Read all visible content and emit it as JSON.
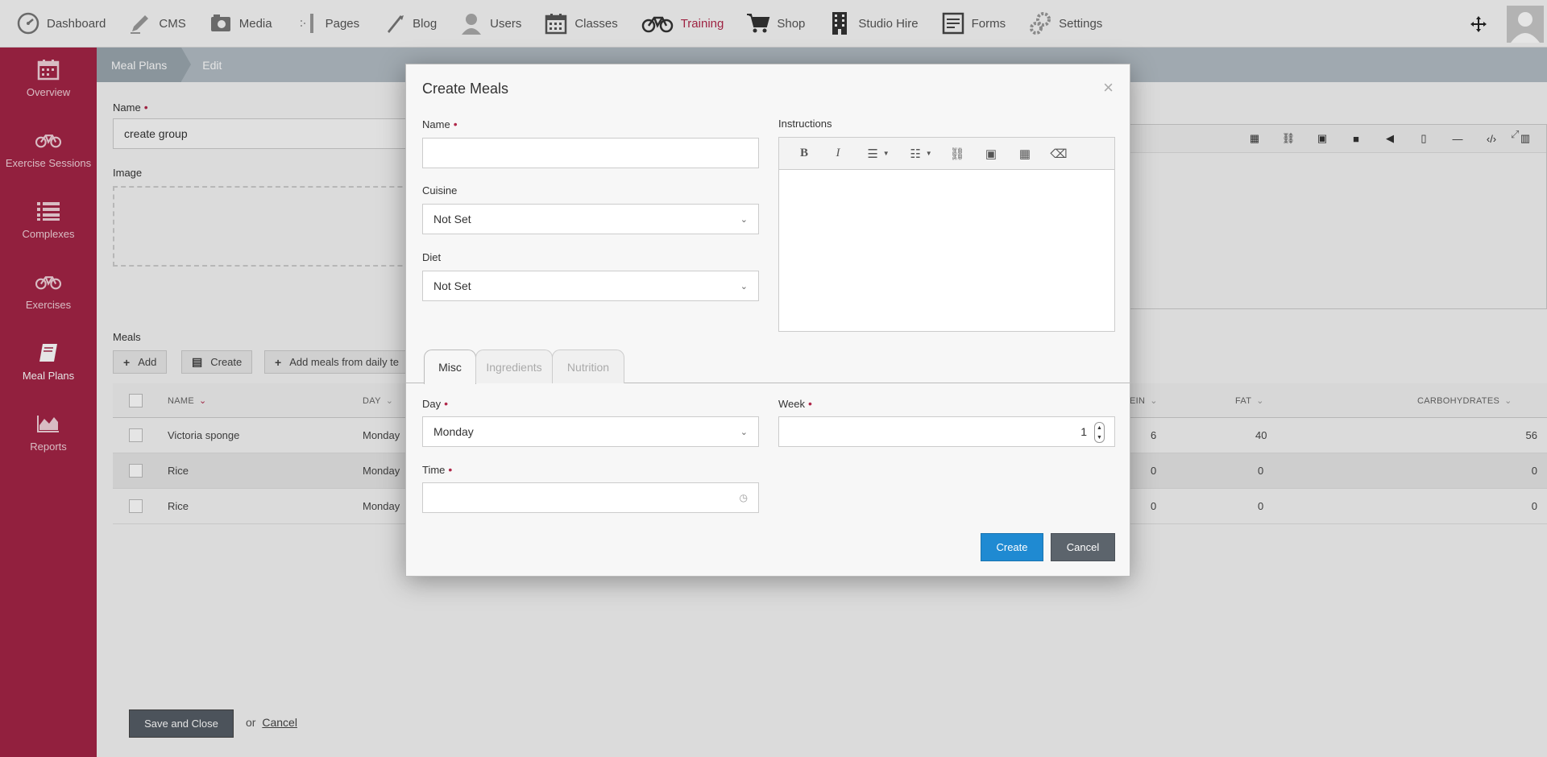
{
  "nav": {
    "items": [
      {
        "label": "Dashboard",
        "icon": "dashboard-gauge-icon"
      },
      {
        "label": "CMS",
        "icon": "pencil-icon"
      },
      {
        "label": "Media",
        "icon": "camera-icon"
      },
      {
        "label": "Pages",
        "icon": "pages-icon"
      },
      {
        "label": "Blog",
        "icon": "quill-icon"
      },
      {
        "label": "Users",
        "icon": "user-icon"
      },
      {
        "label": "Classes",
        "icon": "calendar-icon"
      },
      {
        "label": "Training",
        "icon": "bicycle-icon"
      },
      {
        "label": "Shop",
        "icon": "cart-icon"
      },
      {
        "label": "Studio Hire",
        "icon": "building-icon"
      },
      {
        "label": "Forms",
        "icon": "form-icon"
      },
      {
        "label": "Settings",
        "icon": "gears-icon"
      }
    ],
    "active": "Training",
    "accent": "#b0284a"
  },
  "sidebar": {
    "items": [
      {
        "label": "Overview"
      },
      {
        "label": "Exercise Sessions"
      },
      {
        "label": "Complexes"
      },
      {
        "label": "Exercises"
      },
      {
        "label": "Meal Plans"
      },
      {
        "label": "Reports"
      }
    ],
    "active": "Meal Plans",
    "color": "#a32446"
  },
  "breadcrumb": {
    "first": "Meal Plans",
    "second": "Edit"
  },
  "page": {
    "name_label": "Name",
    "name_value": "create group",
    "image_label": "Image",
    "meals_label": "Meals",
    "add_label": "Add",
    "create_label": "Create",
    "add_from_label": "Add meals from daily te",
    "save_close": "Save and Close",
    "or": "or",
    "cancel": "Cancel"
  },
  "table": {
    "headers": {
      "name": "NAME",
      "day": "DAY",
      "protein": "EIN",
      "fat": "FAT",
      "carbs": "CARBOHYDRATES"
    },
    "rows": [
      {
        "name": "Victoria sponge",
        "day": "Monday",
        "protein": "6",
        "fat": "40",
        "carbs": "56"
      },
      {
        "name": "Rice",
        "day": "Monday",
        "protein": "0",
        "fat": "0",
        "carbs": "0"
      },
      {
        "name": "Rice",
        "day": "Monday",
        "protein": "0",
        "fat": "0",
        "carbs": "0"
      }
    ]
  },
  "modal": {
    "title": "Create Meals",
    "close": "×",
    "name_label": "Name",
    "name_value": "",
    "cuisine_label": "Cuisine",
    "cuisine_value": "Not Set",
    "diet_label": "Diet",
    "diet_value": "Not Set",
    "instructions_label": "Instructions",
    "tabs": [
      "Misc",
      "Ingredients",
      "Nutrition"
    ],
    "active_tab": "Misc",
    "day_label": "Day",
    "day_value": "Monday",
    "week_label": "Week",
    "week_value": "1",
    "time_label": "Time",
    "time_value": "",
    "create_btn": "Create",
    "cancel_btn": "Cancel",
    "create_color": "#1f8ad2"
  }
}
